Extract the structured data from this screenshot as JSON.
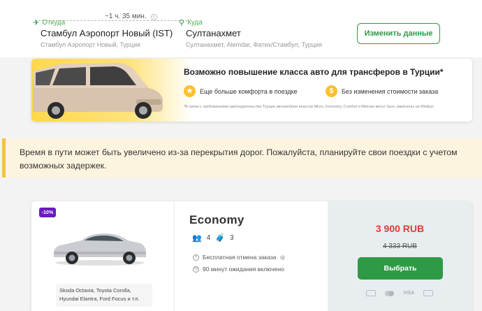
{
  "route": {
    "duration": "~1 ч. 35 мин.",
    "from_label": "Откуда",
    "from_name": "Стамбул Аэропорт Новый (IST)",
    "from_sub": "Стамбул Аэропорт Новый, Турция",
    "to_label": "Куда",
    "to_name": "Султанахмет",
    "to_sub": "Султанахмет, Alemdar, Фатих/Стамбул, Турция",
    "change_button": "Изменить данные"
  },
  "promo": {
    "title": "Возможно повышение класса авто для трансферов в Турции*",
    "benefit1": "Еще больше комфорта в поездке",
    "benefit2": "Без изменения стоимости заказа",
    "note": "*В связи с требованиями законодательства Турции автомобили классов Micro, Economy, Comfort и Minivan могут быть заменены на Minibus"
  },
  "warning": {
    "text": "Время в пути может быть увеличено из-за перекрытия дорог. Пожалуйста, планируйте свои поездки с учетом возможных задержек."
  },
  "vehicle": {
    "discount_badge": "-10%",
    "class_name": "Economy",
    "passengers": "4",
    "luggage": "3",
    "feature1": "Бесплатная отмена заказа",
    "feature2": "90 минут ожидания включено",
    "models": "Skoda Octavia, Toyota Corolla, Hyundai Elantra, Ford Focus и т.п.",
    "price": "3 900 RUB",
    "old_price": "4 333 RUB",
    "select_button": "Выбрать",
    "payment_methods": [
      "cash-icon",
      "mastercard-icon",
      "VISA",
      "card-icon"
    ],
    "visa_label": "VISA"
  },
  "colors": {
    "accent_green": "#2e9a45",
    "price_red": "#e53935",
    "badge_purple": "#6a1bbf",
    "warning_bg": "#fdf4df",
    "warning_border": "#f5c242",
    "promo_yellow": "#ffd84d"
  }
}
